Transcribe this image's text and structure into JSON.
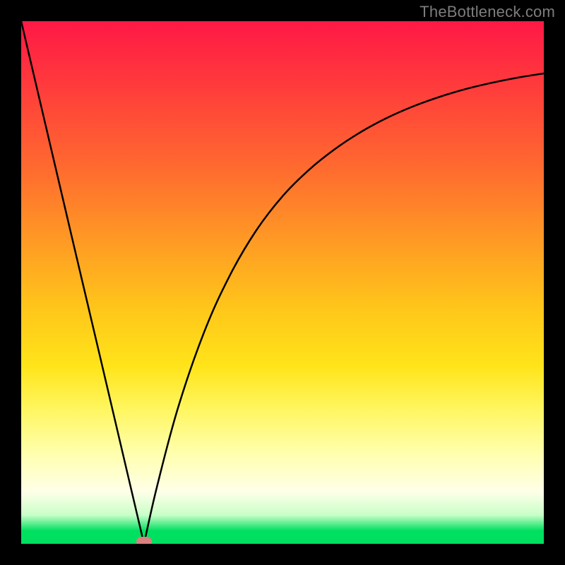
{
  "watermark": "TheBottleneck.com",
  "chart_data": {
    "type": "line",
    "title": "",
    "xlabel": "",
    "ylabel": "",
    "xlim": [
      0,
      100
    ],
    "ylim": [
      0,
      100
    ],
    "grid": false,
    "legend": false,
    "series": [
      {
        "name": "left-branch",
        "x": [
          0,
          5,
          10,
          15,
          20,
          23.5
        ],
        "values": [
          100,
          78.7,
          57.4,
          36.2,
          14.9,
          0
        ]
      },
      {
        "name": "right-branch",
        "x": [
          23.5,
          26,
          30,
          35,
          40,
          45,
          50,
          55,
          60,
          65,
          70,
          75,
          80,
          85,
          90,
          95,
          100
        ],
        "values": [
          0,
          11,
          26,
          40.5,
          51.5,
          60,
          66.5,
          71.5,
          75.5,
          78.8,
          81.5,
          83.7,
          85.5,
          87,
          88.2,
          89.2,
          90
        ]
      }
    ],
    "marker": {
      "x": 23.5,
      "y": 0,
      "color": "#d98080"
    },
    "background_gradient": {
      "top": "#ff1846",
      "bottom": "#00e060"
    }
  }
}
